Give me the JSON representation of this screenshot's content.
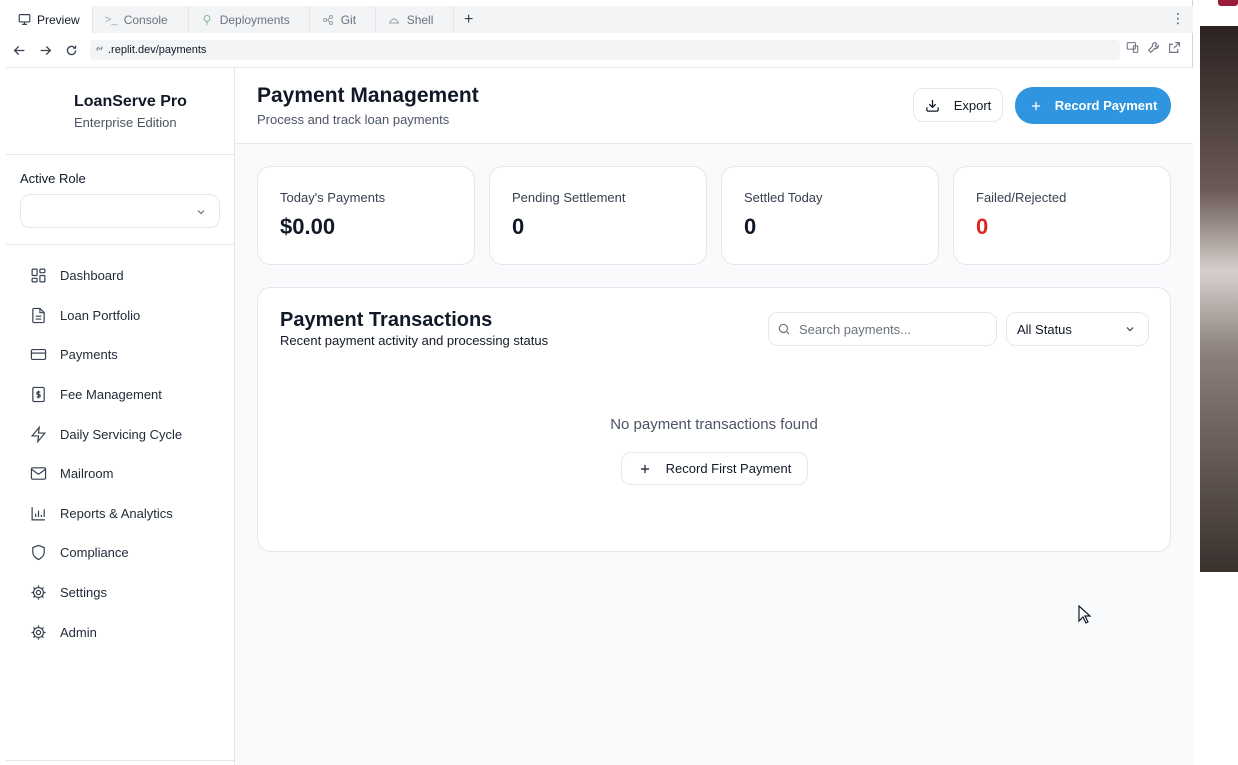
{
  "browser": {
    "tabs": [
      {
        "label": "Preview",
        "icon": "monitor-icon",
        "active": true
      },
      {
        "label": "Console",
        "icon": "terminal-icon"
      },
      {
        "label": "Deployments",
        "icon": "deploy-icon"
      },
      {
        "label": "Git",
        "icon": "git-icon"
      },
      {
        "label": "Shell",
        "icon": "shell-icon"
      }
    ],
    "url": ".replit.dev/payments"
  },
  "sidebar": {
    "brand_name": "LoanServe Pro",
    "brand_sub": "Enterprise Edition",
    "role_label": "Active Role",
    "role_value": "",
    "items": [
      {
        "label": "Dashboard",
        "icon": "dashboard-icon"
      },
      {
        "label": "Loan Portfolio",
        "icon": "document-icon"
      },
      {
        "label": "Payments",
        "icon": "credit-card-icon"
      },
      {
        "label": "Fee Management",
        "icon": "dollar-receipt-icon"
      },
      {
        "label": "Daily Servicing Cycle",
        "icon": "lightning-icon"
      },
      {
        "label": "Mailroom",
        "icon": "mail-icon"
      },
      {
        "label": "Reports & Analytics",
        "icon": "bar-chart-icon"
      },
      {
        "label": "Compliance",
        "icon": "shield-icon"
      },
      {
        "label": "Settings",
        "icon": "gear-icon"
      },
      {
        "label": "Admin",
        "icon": "gear-icon"
      }
    ]
  },
  "header": {
    "title": "Payment Management",
    "subtitle": "Process and track loan payments",
    "export_label": "Export",
    "record_label": "Record Payment"
  },
  "stats": [
    {
      "label": "Today's Payments",
      "value": "$0.00"
    },
    {
      "label": "Pending Settlement",
      "value": "0"
    },
    {
      "label": "Settled Today",
      "value": "0"
    },
    {
      "label": "Failed/Rejected",
      "value": "0",
      "color": "#dc2626"
    }
  ],
  "transactions": {
    "title": "Payment Transactions",
    "subtitle": "Recent payment activity and processing status",
    "search_placeholder": "Search payments...",
    "status_filter": "All Status",
    "empty_message": "No payment transactions found",
    "empty_action": "Record First Payment"
  },
  "colors": {
    "accent": "#2f95e0",
    "danger": "#dc2626"
  }
}
